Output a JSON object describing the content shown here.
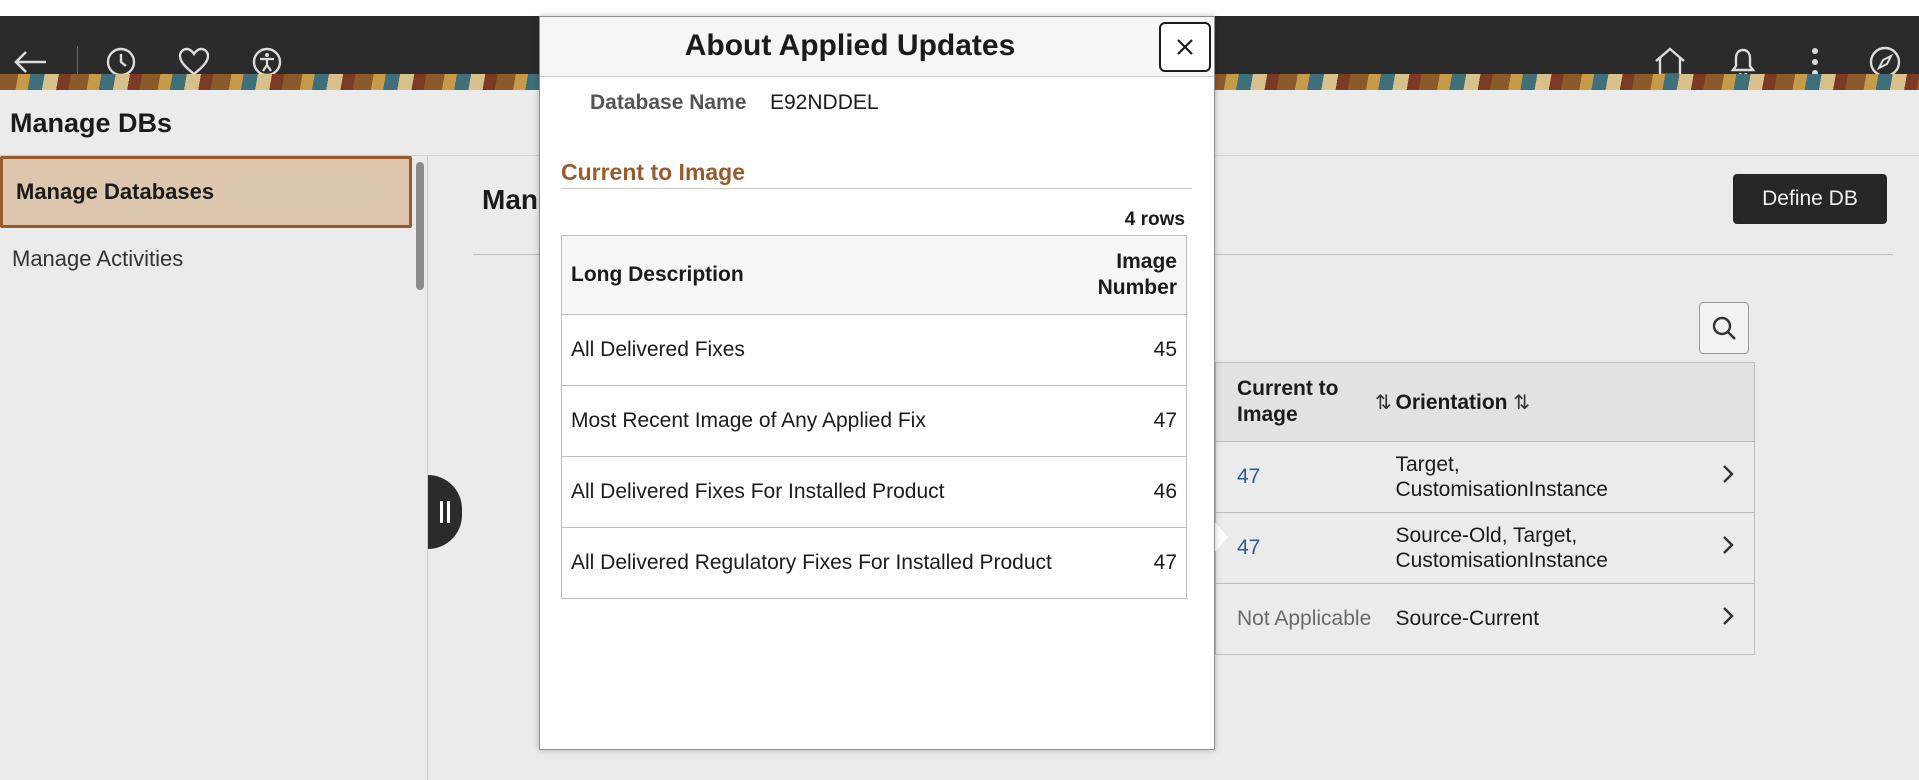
{
  "header": {
    "icons": [
      "back-arrow-icon",
      "history-icon",
      "heart-icon",
      "accessibility-icon",
      "home-icon",
      "bell-icon",
      "more-vertical-icon",
      "compass-icon"
    ]
  },
  "page": {
    "title": "Manage DBs"
  },
  "sidebar": {
    "items": [
      {
        "label": "Manage Databases",
        "active": true
      },
      {
        "label": "Manage Activities",
        "active": false
      }
    ]
  },
  "main": {
    "title": "Man",
    "define_button": "Define DB",
    "grid": {
      "columns": [
        "Current to Image",
        "Orientation"
      ],
      "rows": [
        {
          "image": "47",
          "orientation": "Target, CustomisationInstance"
        },
        {
          "image": "47",
          "orientation": "Source-Old, Target, CustomisationInstance"
        },
        {
          "image": "Not Applicable",
          "orientation": "Source-Current"
        }
      ]
    }
  },
  "modal": {
    "title": "About Applied Updates",
    "db_label": "Database Name",
    "db_value": "E92NDDEL",
    "section_title": "Current to Image",
    "row_count": "4 rows",
    "columns": {
      "desc": "Long Description",
      "image_line1": "Image",
      "image_line2": "Number"
    },
    "rows": [
      {
        "desc": "All Delivered Fixes",
        "number": "45"
      },
      {
        "desc": "Most Recent Image of Any Applied Fix",
        "number": "47"
      },
      {
        "desc": "All Delivered Fixes For Installed Product",
        "number": "46"
      },
      {
        "desc": "All Delivered Regulatory Fixes For Installed Product",
        "number": "47"
      }
    ]
  }
}
